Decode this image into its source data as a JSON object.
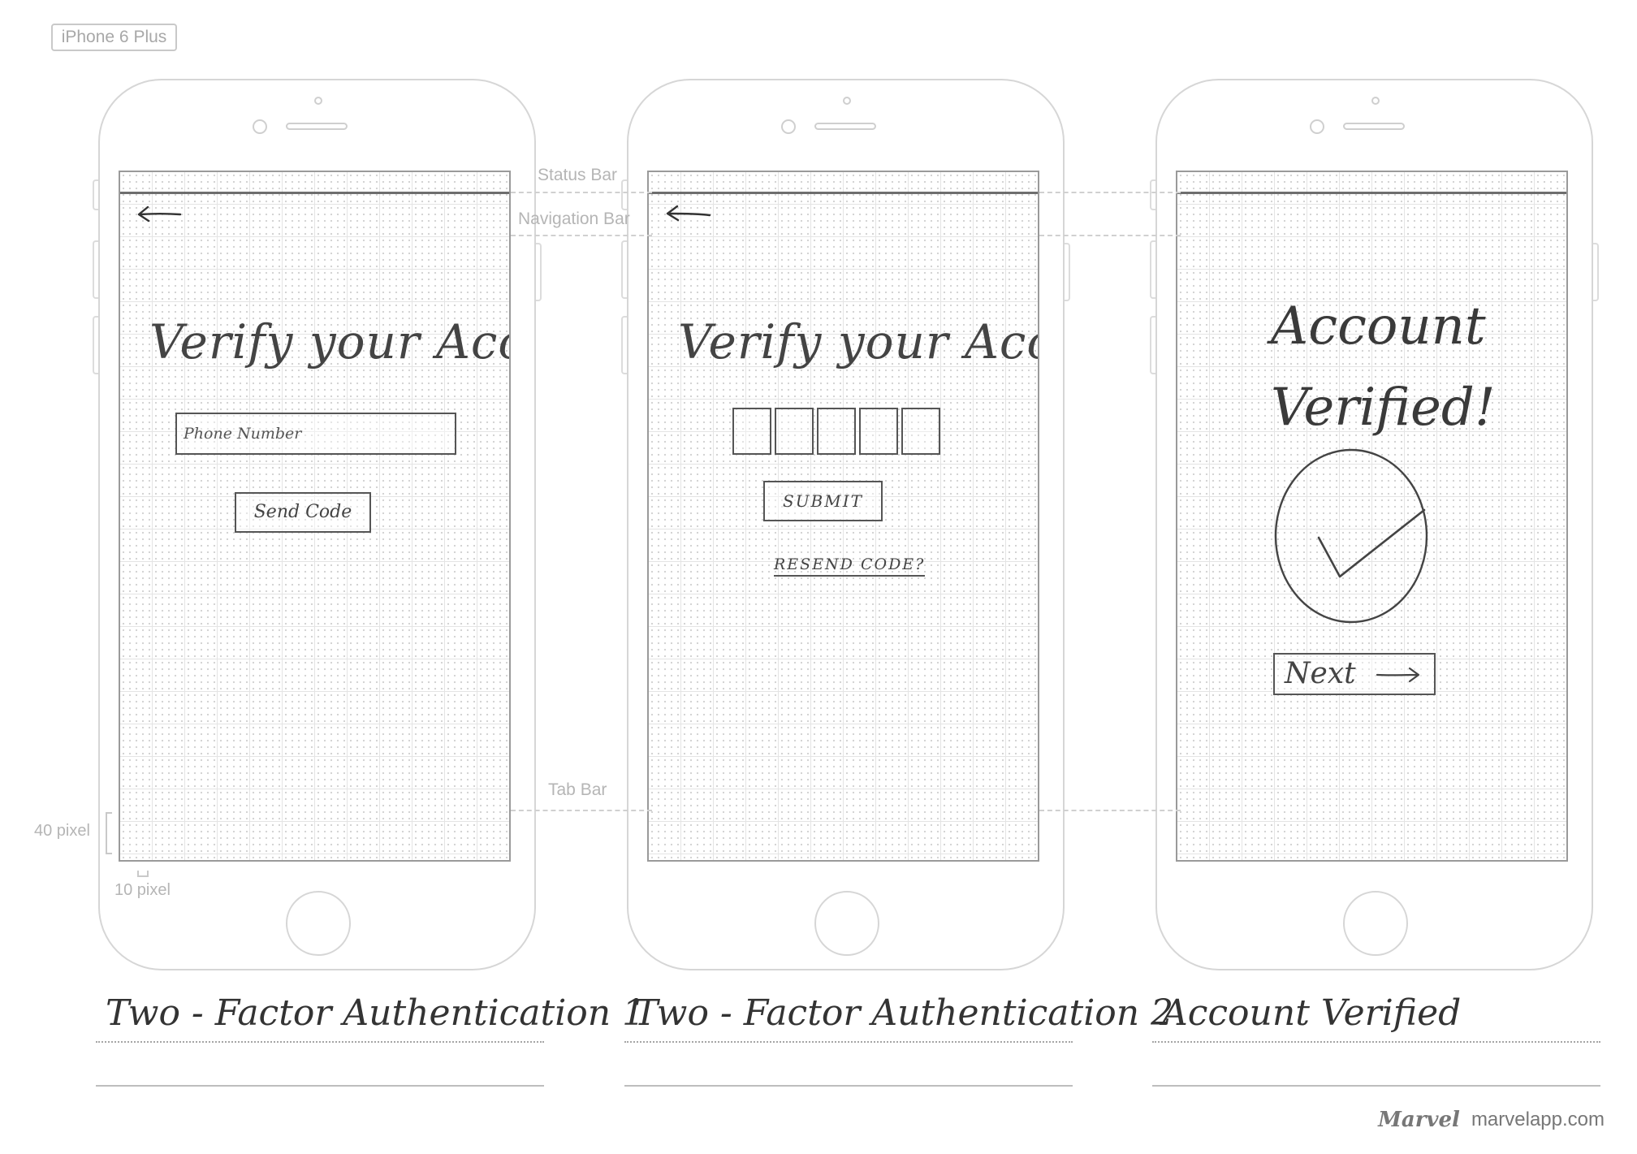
{
  "device_label": "iPhone 6 Plus",
  "annotations": {
    "status_bar": "Status Bar",
    "navigation_bar": "Navigation Bar",
    "tab_bar": "Tab Bar",
    "height_note": "40 pixel",
    "width_note": "10 pixel"
  },
  "screens": {
    "auth1": {
      "title": "Verify your Account",
      "phone_placeholder": "Phone Number",
      "send_button": "Send Code",
      "caption": "Two - Factor Authentication 1"
    },
    "auth2": {
      "title": "Verify your Account",
      "submit_button": "SUBMIT",
      "resend_link": "RESEND CODE?",
      "caption": "Two - Factor Authentication 2"
    },
    "verified": {
      "title_line1": "Account",
      "title_line2": "Verified!",
      "next_button": "Next",
      "caption": "Account Verified"
    }
  },
  "icons": {
    "back": "arrow-left-icon",
    "check": "checkmark-circle-icon",
    "next": "arrow-right-icon"
  },
  "footer": {
    "brand": "Marvel",
    "site": "marvelapp.com"
  },
  "colors": {
    "sketch_ink": "#444444",
    "device_outline": "#d6d6d6",
    "annotation": "#b5b5b5"
  }
}
